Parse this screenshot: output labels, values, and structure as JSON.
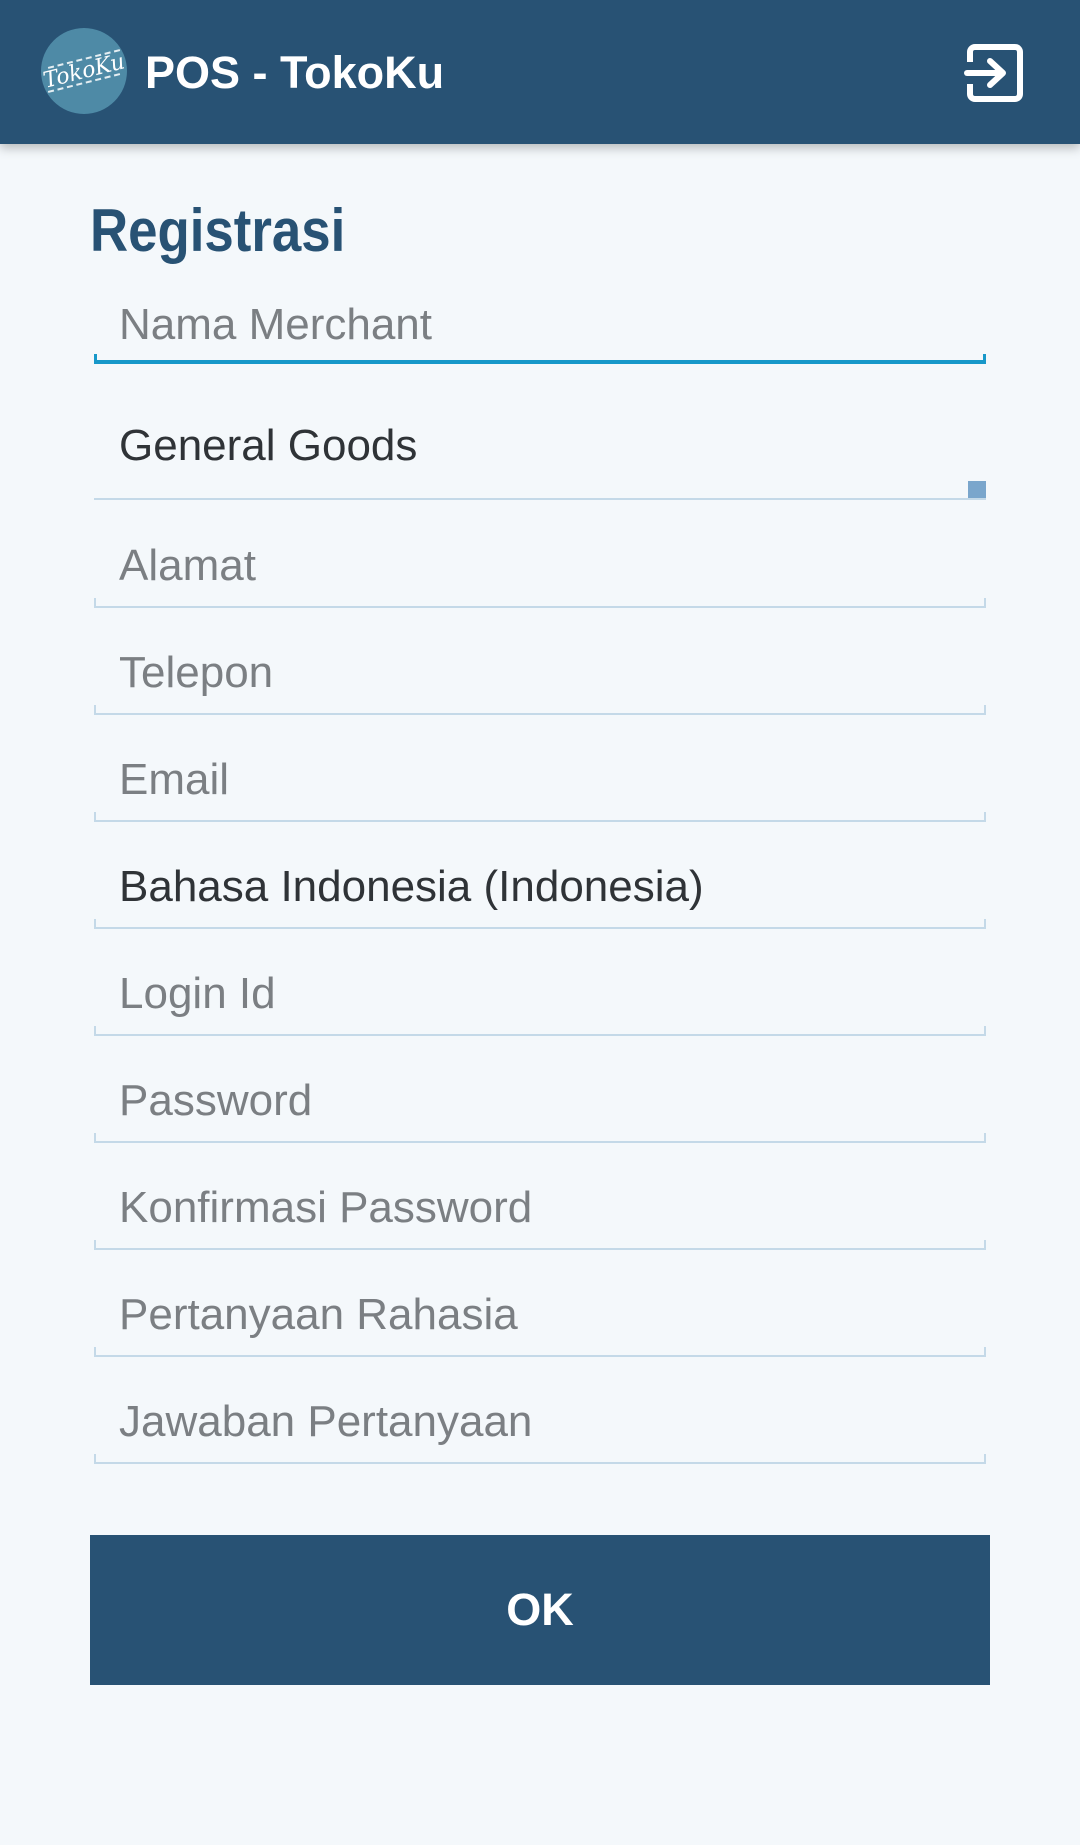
{
  "appbar": {
    "logo_text": "TokoKu",
    "title": "POS - TokoKu",
    "exit_icon": "logout-icon"
  },
  "form": {
    "title": "Registrasi",
    "merchant_name_placeholder": "Nama Merchant",
    "merchant_type_value": "General Goods",
    "address_placeholder": "Alamat",
    "phone_placeholder": "Telepon",
    "email_placeholder": "Email",
    "language_value": "Bahasa Indonesia (Indonesia)",
    "login_id_placeholder": "Login Id",
    "password_placeholder": "Password",
    "confirm_password_placeholder": "Konfirmasi Password",
    "secret_question_placeholder": "Pertanyaan Rahasia",
    "secret_answer_placeholder": "Jawaban Pertanyaan",
    "ok_label": "OK"
  },
  "colors": {
    "primary": "#285274",
    "accent": "#1798c9",
    "background": "#f4f8fb"
  }
}
